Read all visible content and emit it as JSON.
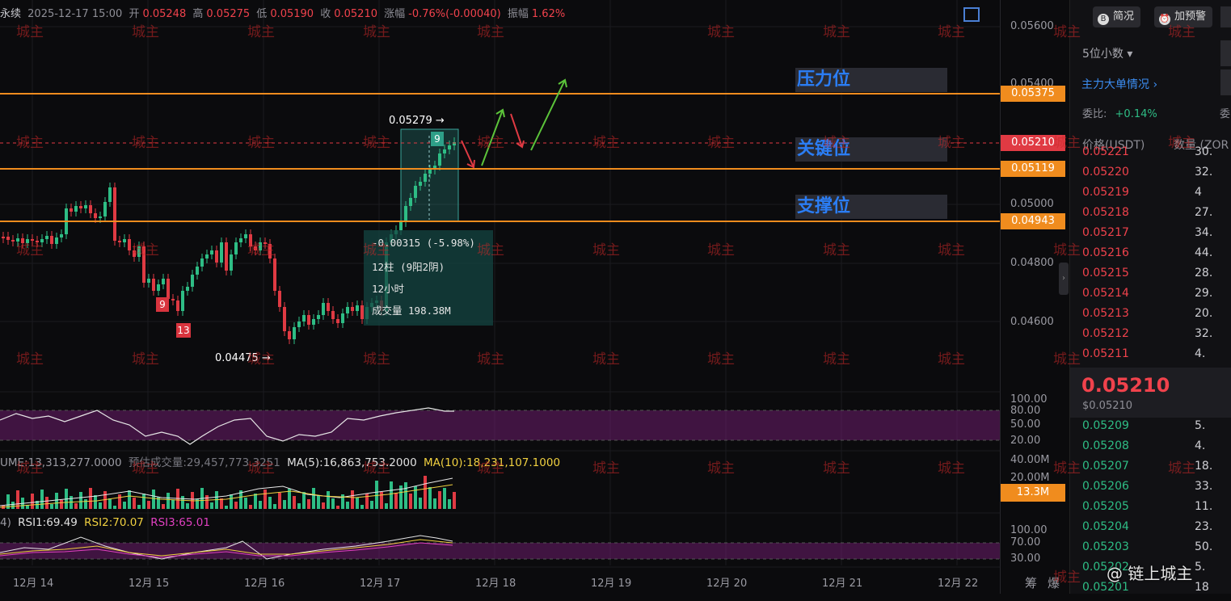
{
  "header": {
    "symbol_suffix": "永续",
    "datetime": "2025-12-17 15:00",
    "open_label": "开",
    "open": "0.05248",
    "high_label": "高",
    "high": "0.05275",
    "low_label": "低",
    "low": "0.05190",
    "close_label": "收",
    "close": "0.05210",
    "change_label": "涨幅",
    "change": "-0.76%(-0.00040)",
    "amplitude_label": "振幅",
    "amplitude": "1.62%"
  },
  "price_axis": {
    "ticks": [
      "0.05600",
      "0.05400",
      "0.05000",
      "0.04800",
      "0.04600"
    ],
    "levels": {
      "resistance": "0.05375",
      "current": "0.05210",
      "key": "0.05119",
      "support": "0.04943"
    },
    "colors": {
      "level_line": "#f08c1e",
      "current_line": "#e03a43"
    }
  },
  "zones": {
    "resistance": "压力位",
    "key": "关键位",
    "support": "支撑位"
  },
  "annotations": {
    "high_marker": "0.05279 →",
    "low_marker": "0.04475 →",
    "seq9_a": "9",
    "seq9_b": "9",
    "seq13": "13"
  },
  "stat_box": {
    "change": "-0.00315 (-5.98%)",
    "bars": "12柱 (9阳2阴)",
    "duration": "12小时",
    "volume": "成交量 198.38M"
  },
  "indicator_axis": {
    "osc": [
      "100.00",
      "80.00",
      "50.00",
      "20.00"
    ],
    "vol": [
      "40.00M",
      "20.00M"
    ],
    "vol_tag": "13.3M",
    "rsi": [
      "100.00",
      "70.00",
      "30.00"
    ]
  },
  "volume_legend": {
    "volume": "UME:13,313,277.0000",
    "est": "预估成交量:29,457,773.3251",
    "ma5": "MA(5):16,863,753.2000",
    "ma10": "MA(10):18,231,107.1000"
  },
  "rsi_legend": {
    "prefix": "4)",
    "rsi1": "RSI1:69.49",
    "rsi2": "RSI2:70.07",
    "rsi3": "RSI3:65.01"
  },
  "dates": [
    "12月 14",
    "12月 15",
    "12月 16",
    "12月 17",
    "12月 18",
    "12月 19",
    "12月 20",
    "12月 21",
    "12月 22"
  ],
  "bottom_icons": {
    "chips": "筹",
    "liq": "爆"
  },
  "watermark": "城主",
  "brand": "@ 链上城主",
  "side": {
    "btn_simple": "简况",
    "btn_alert": "加预警",
    "precision": "5位小数",
    "main_orders": "主力大单情况",
    "ratio_label": "委比:",
    "ratio_value": "+0.14%",
    "ratio_label2": "委",
    "col_price": "价格(USDT)",
    "col_qty": "数量 (ZOR",
    "last_price": "0.05210",
    "last_usd": "$0.05210",
    "asks": [
      {
        "p": "0.05221",
        "q": "30."
      },
      {
        "p": "0.05220",
        "q": "32."
      },
      {
        "p": "0.05219",
        "q": "4"
      },
      {
        "p": "0.05218",
        "q": "27."
      },
      {
        "p": "0.05217",
        "q": "34."
      },
      {
        "p": "0.05216",
        "q": "44."
      },
      {
        "p": "0.05215",
        "q": "28."
      },
      {
        "p": "0.05214",
        "q": "29."
      },
      {
        "p": "0.05213",
        "q": "20."
      },
      {
        "p": "0.05212",
        "q": "32."
      },
      {
        "p": "0.05211",
        "q": "4."
      }
    ],
    "bids": [
      {
        "p": "0.05209",
        "q": "5."
      },
      {
        "p": "0.05208",
        "q": "4."
      },
      {
        "p": "0.05207",
        "q": "18."
      },
      {
        "p": "0.05206",
        "q": "33."
      },
      {
        "p": "0.05205",
        "q": "11."
      },
      {
        "p": "0.05204",
        "q": "23."
      },
      {
        "p": "0.05203",
        "q": "50."
      },
      {
        "p": "0.05202",
        "q": "5."
      },
      {
        "p": "0.05201",
        "q": "18"
      }
    ]
  }
}
